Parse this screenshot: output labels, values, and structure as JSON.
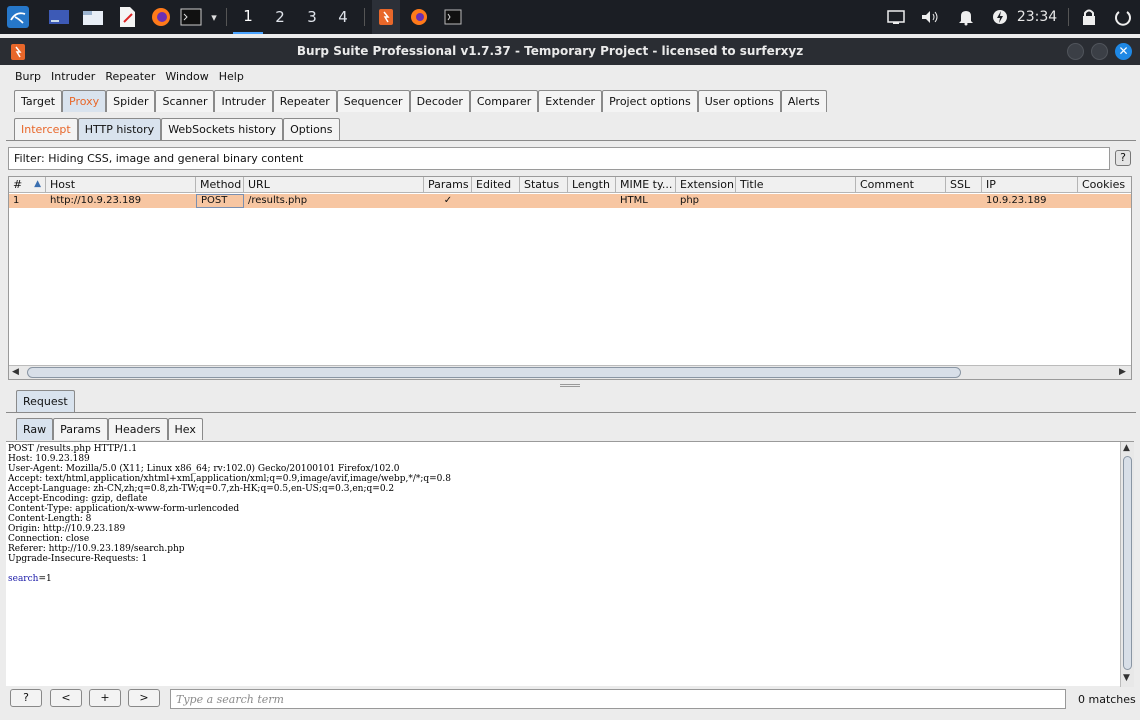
{
  "taskbar": {
    "workspaces": [
      "1",
      "2",
      "3",
      "4"
    ],
    "active_workspace": "1",
    "clock": "23:34"
  },
  "window": {
    "title": "Burp Suite Professional v1.7.37 - Temporary Project - licensed to surferxyz",
    "close_glyph": "✕"
  },
  "menu": [
    "Burp",
    "Intruder",
    "Repeater",
    "Window",
    "Help"
  ],
  "main_tabs": [
    "Target",
    "Proxy",
    "Spider",
    "Scanner",
    "Intruder",
    "Repeater",
    "Sequencer",
    "Decoder",
    "Comparer",
    "Extender",
    "Project options",
    "User options",
    "Alerts"
  ],
  "proxy_tabs": [
    "Intercept",
    "HTTP history",
    "WebSockets history",
    "Options"
  ],
  "filter": {
    "text": "Filter: Hiding CSS, image and general binary content",
    "help": "?"
  },
  "history": {
    "columns": [
      "#",
      "Host",
      "Method",
      "URL",
      "Params",
      "Edited",
      "Status",
      "Length",
      "MIME ty...",
      "Extension",
      "Title",
      "Comment",
      "SSL",
      "IP",
      "Cookies"
    ],
    "sort_indicator": "▲",
    "rows": [
      {
        "num": "1",
        "host": "http://10.9.23.189",
        "method": "POST",
        "url": "/results.php",
        "params": "✓",
        "edited": "",
        "status": "",
        "length": "",
        "mime": "HTML",
        "extension": "php",
        "title": "",
        "comment": "",
        "ssl": "",
        "ip": "10.9.23.189",
        "cookies": ""
      }
    ]
  },
  "request_panel": {
    "tab": "Request",
    "subtabs": [
      "Raw",
      "Params",
      "Headers",
      "Hex"
    ],
    "raw_lines": [
      "POST /results.php HTTP/1.1",
      "Host: 10.9.23.189",
      "User-Agent: Mozilla/5.0 (X11; Linux x86_64; rv:102.0) Gecko/20100101 Firefox/102.0",
      "Accept: text/html,application/xhtml+xml,application/xml;q=0.9,image/avif,image/webp,*/*;q=0.8",
      "Accept-Language: zh-CN,zh;q=0.8,zh-TW;q=0.7,zh-HK;q=0.5,en-US;q=0.3,en;q=0.2",
      "Accept-Encoding: gzip, deflate",
      "Content-Type: application/x-www-form-urlencoded",
      "Content-Length: 8",
      "Origin: http://10.9.23.189",
      "Connection: close",
      "Referer: http://10.9.23.189/search.php",
      "Upgrade-Insecure-Requests: 1"
    ],
    "body_param_name": "search",
    "body_param_rest": "=1"
  },
  "search": {
    "help": "?",
    "prev": "<",
    "add": "+",
    "next": ">",
    "placeholder": "Type a search term",
    "matches": "0 matches"
  }
}
